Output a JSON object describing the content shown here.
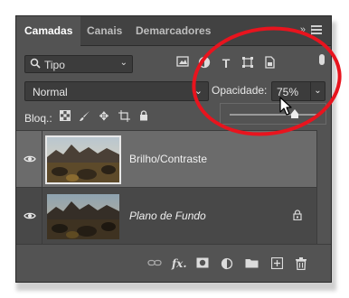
{
  "tabs": [
    {
      "label": "Camadas",
      "active": true
    },
    {
      "label": "Canais",
      "active": false
    },
    {
      "label": "Demarcadores",
      "active": false
    }
  ],
  "filter": {
    "label": "Tipo"
  },
  "blend_mode": {
    "value": "Normal"
  },
  "opacity": {
    "label": "Opacidade:",
    "value": "75%",
    "slider_fraction": 0.75
  },
  "lock": {
    "label": "Bloq.:"
  },
  "layers": [
    {
      "name": "Brilho/Contraste",
      "visible": true,
      "selected": true,
      "locked": false
    },
    {
      "name": "Plano de Fundo",
      "visible": true,
      "selected": false,
      "locked": true
    }
  ],
  "colors": {
    "panel": "#535353",
    "highlight_ring": "#e8141e",
    "selected_layer": "#6b6b6b"
  },
  "icons": {
    "filter": [
      "image-filter-icon",
      "adjustment-filter-icon",
      "type-filter-icon",
      "shape-filter-icon",
      "smart-object-filter-icon"
    ],
    "lock": [
      "lock-transparent-icon",
      "lock-image-icon",
      "lock-position-icon",
      "lock-artboard-icon",
      "lock-all-icon"
    ],
    "bottom": [
      "link-icon",
      "fx-icon",
      "mask-icon",
      "adjustment-layer-icon",
      "group-icon",
      "new-layer-icon",
      "trash-icon"
    ]
  }
}
